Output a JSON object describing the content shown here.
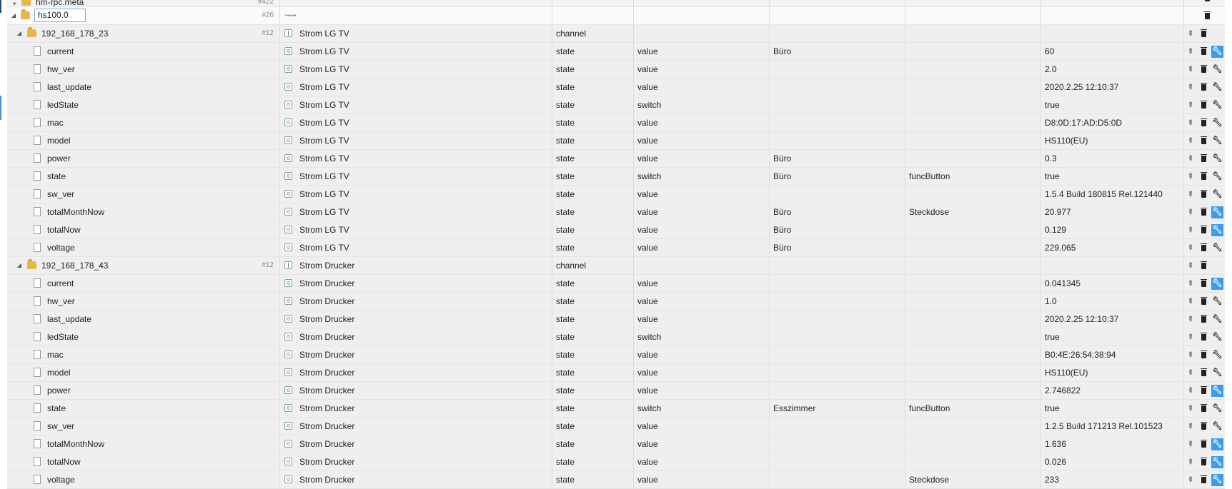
{
  "top_row": {
    "name": "hm-rpc.meta",
    "count": "#422"
  },
  "root": {
    "name": "hs100.0",
    "count": "#26"
  },
  "channels": [
    {
      "name": "192_168_178_23",
      "count": "#12",
      "title": "Strom LG TV",
      "type": "channel",
      "states": [
        {
          "name": "current",
          "type": "state",
          "role": "value",
          "room": "Büro",
          "func": "",
          "value": "60",
          "tool_active": true
        },
        {
          "name": "hw_ver",
          "type": "state",
          "role": "value",
          "room": "",
          "func": "",
          "value": "2.0",
          "tool_active": false
        },
        {
          "name": "last_update",
          "type": "state",
          "role": "value",
          "room": "",
          "func": "",
          "value": "2020.2.25 12:10:37",
          "tool_active": false
        },
        {
          "name": "ledState",
          "type": "state",
          "role": "switch",
          "room": "",
          "func": "",
          "value": "true",
          "tool_active": false
        },
        {
          "name": "mac",
          "type": "state",
          "role": "value",
          "room": "",
          "func": "",
          "value": "D8:0D:17:AD:D5:0D",
          "tool_active": false
        },
        {
          "name": "model",
          "type": "state",
          "role": "value",
          "room": "",
          "func": "",
          "value": "HS110(EU)",
          "tool_active": false
        },
        {
          "name": "power",
          "type": "state",
          "role": "value",
          "room": "Büro",
          "func": "",
          "value": "0.3",
          "tool_active": false
        },
        {
          "name": "state",
          "type": "state",
          "role": "switch",
          "room": "Büro",
          "func": "funcButton",
          "value": "true",
          "tool_active": false
        },
        {
          "name": "sw_ver",
          "type": "state",
          "role": "value",
          "room": "",
          "func": "",
          "value": "1.5.4 Build 180815 Rel.121440",
          "tool_active": false
        },
        {
          "name": "totalMonthNow",
          "type": "state",
          "role": "value",
          "room": "Büro",
          "func": "Steckdose",
          "value": "20.977",
          "tool_active": true
        },
        {
          "name": "totalNow",
          "type": "state",
          "role": "value",
          "room": "Büro",
          "func": "",
          "value": "0.129",
          "tool_active": true
        },
        {
          "name": "voltage",
          "type": "state",
          "role": "value",
          "room": "Büro",
          "func": "",
          "value": "229.065",
          "tool_active": false
        }
      ]
    },
    {
      "name": "192_168_178_43",
      "count": "#12",
      "title": "Strom Drucker",
      "type": "channel",
      "states": [
        {
          "name": "current",
          "type": "state",
          "role": "value",
          "room": "",
          "func": "",
          "value": "0.041345",
          "tool_active": true
        },
        {
          "name": "hw_ver",
          "type": "state",
          "role": "value",
          "room": "",
          "func": "",
          "value": "1.0",
          "tool_active": false
        },
        {
          "name": "last_update",
          "type": "state",
          "role": "value",
          "room": "",
          "func": "",
          "value": "2020.2.25 12:10:37",
          "tool_active": false
        },
        {
          "name": "ledState",
          "type": "state",
          "role": "switch",
          "room": "",
          "func": "",
          "value": "true",
          "tool_active": false
        },
        {
          "name": "mac",
          "type": "state",
          "role": "value",
          "room": "",
          "func": "",
          "value": "B0:4E:26:54:38:94",
          "tool_active": false
        },
        {
          "name": "model",
          "type": "state",
          "role": "value",
          "room": "",
          "func": "",
          "value": "HS110(EU)",
          "tool_active": false
        },
        {
          "name": "power",
          "type": "state",
          "role": "value",
          "room": "",
          "func": "",
          "value": "2.746822",
          "tool_active": true
        },
        {
          "name": "state",
          "type": "state",
          "role": "switch",
          "room": "Esszimmer",
          "func": "funcButton",
          "value": "true",
          "tool_active": false
        },
        {
          "name": "sw_ver",
          "type": "state",
          "role": "value",
          "room": "",
          "func": "",
          "value": "1.2.5 Build 171213 Rel.101523",
          "tool_active": false
        },
        {
          "name": "totalMonthNow",
          "type": "state",
          "role": "value",
          "room": "",
          "func": "",
          "value": "1.636",
          "tool_active": true
        },
        {
          "name": "totalNow",
          "type": "state",
          "role": "value",
          "room": "",
          "func": "",
          "value": "0.026",
          "tool_active": true
        },
        {
          "name": "voltage",
          "type": "state",
          "role": "value",
          "room": "",
          "func": "Steckdose",
          "value": "233",
          "tool_active": true
        }
      ]
    }
  ],
  "colors": {
    "accent": "#3d9be9",
    "folder": "#e6b84a",
    "row_bg": "#efefef"
  }
}
